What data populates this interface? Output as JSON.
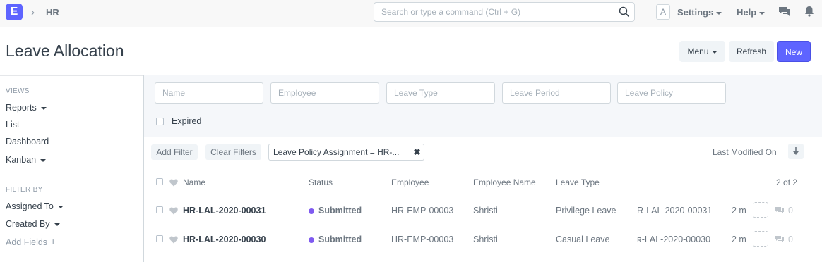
{
  "navbar": {
    "logo_letter": "E",
    "breadcrumb": "HR",
    "search_placeholder": "Search or type a command (Ctrl + G)",
    "avatar_letter": "A",
    "settings_label": "Settings",
    "help_label": "Help"
  },
  "header": {
    "title": "Leave Allocation",
    "menu_label": "Menu",
    "refresh_label": "Refresh",
    "new_label": "New"
  },
  "sidebar": {
    "views_heading": "VIEWS",
    "views": [
      "Reports",
      "List",
      "Dashboard",
      "Kanban"
    ],
    "filter_heading": "FILTER BY",
    "filters": [
      "Assigned To",
      "Created By"
    ],
    "add_fields_label": "Add Fields"
  },
  "filters": {
    "placeholders": [
      "Name",
      "Employee",
      "Leave Type",
      "Leave Period",
      "Leave Policy"
    ],
    "expired_label": "Expired",
    "add_filter_label": "Add Filter",
    "clear_filters_label": "Clear Filters",
    "active_filter": "Leave Policy Assignment = HR-...",
    "sort_label": "Last Modified On"
  },
  "table": {
    "columns": [
      "Name",
      "Status",
      "Employee",
      "Employee Name",
      "Leave Type"
    ],
    "count": "2 of 2",
    "rows": [
      {
        "name": "HR-LAL-2020-00031",
        "status": "Submitted",
        "employee": "HR-EMP-00003",
        "employee_name": "Shristi",
        "leave_type": "Privilege Leave",
        "ref": "R-LAL-2020-00031",
        "modified": "2 m",
        "comments": "0"
      },
      {
        "name": "HR-LAL-2020-00030",
        "status": "Submitted",
        "employee": "HR-EMP-00003",
        "employee_name": "Shristi",
        "leave_type": "Casual Leave",
        "ref": "ʀ-LAL-2020-00030",
        "modified": "2 m",
        "comments": "0"
      }
    ]
  },
  "colors": {
    "primary": "#5e64ff",
    "status_submitted": "#7f5af0"
  }
}
